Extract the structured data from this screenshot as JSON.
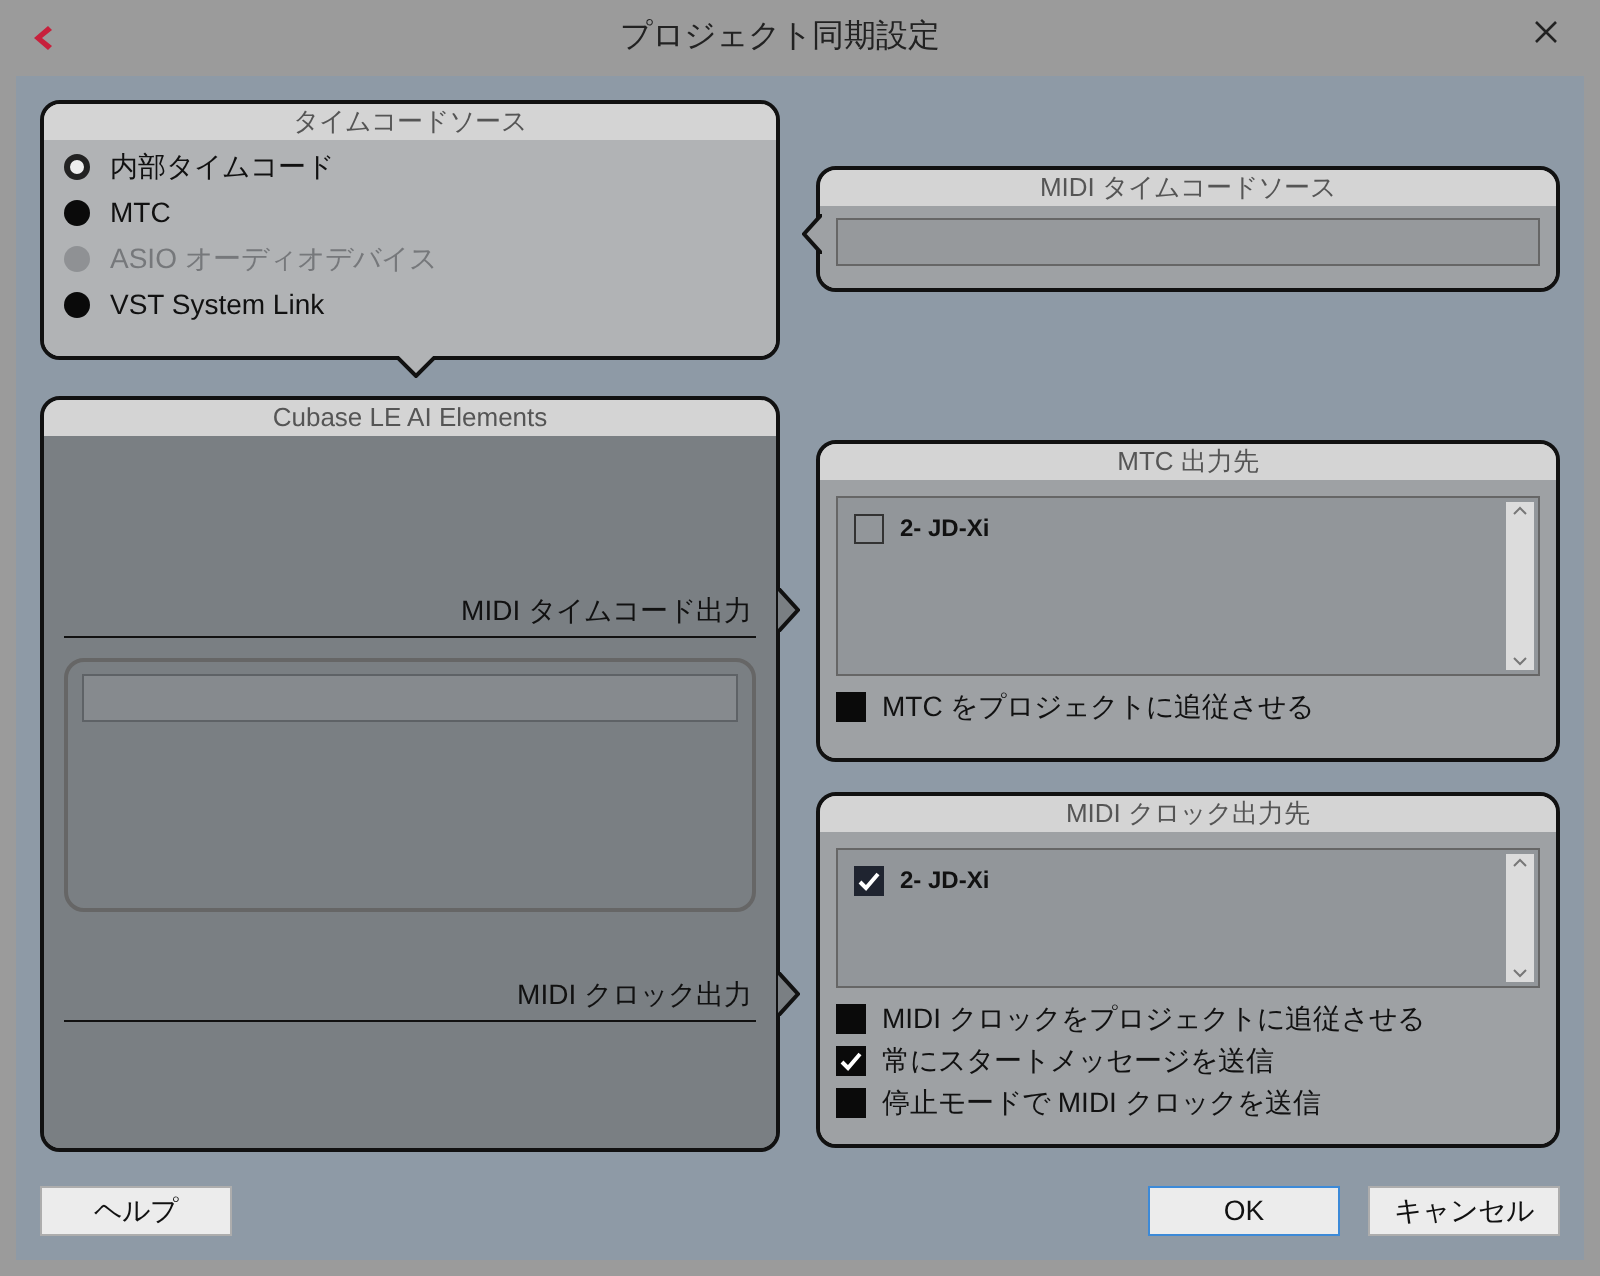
{
  "window": {
    "title": "プロジェクト同期設定"
  },
  "timecode_source": {
    "title": "タイムコードソース",
    "options": [
      {
        "label": "内部タイムコード",
        "selected": true,
        "disabled": false
      },
      {
        "label": "MTC",
        "selected": false,
        "disabled": false
      },
      {
        "label": "ASIO オーディオデバイス",
        "selected": false,
        "disabled": true
      },
      {
        "label": "VST System Link",
        "selected": false,
        "disabled": false
      }
    ]
  },
  "midi_timecode_source": {
    "title": "MIDI タイムコードソース"
  },
  "app_panel": {
    "title": "Cubase LE AI Elements",
    "outputs": [
      {
        "label": "MIDI タイムコード出力"
      },
      {
        "label": "MIDI クロック出力"
      }
    ]
  },
  "mtc_destination": {
    "title": "MTC 出力先",
    "ports": [
      {
        "label": "2- JD-Xi",
        "checked": false
      }
    ],
    "options": [
      {
        "label": "MTC をプロジェクトに追従させる",
        "checked": false
      }
    ]
  },
  "midi_clock_destination": {
    "title": "MIDI クロック出力先",
    "ports": [
      {
        "label": "2- JD-Xi",
        "checked": true
      }
    ],
    "options": [
      {
        "label": "MIDI クロックをプロジェクトに追従させる",
        "checked": false
      },
      {
        "label": "常にスタートメッセージを送信",
        "checked": true
      },
      {
        "label": "停止モードで MIDI クロックを送信",
        "checked": false
      }
    ]
  },
  "buttons": [
    {
      "label": "ヘルプ",
      "kind": "help"
    },
    {
      "label": "OK",
      "kind": "default"
    },
    {
      "label": "キャンセル",
      "kind": "normal"
    }
  ]
}
